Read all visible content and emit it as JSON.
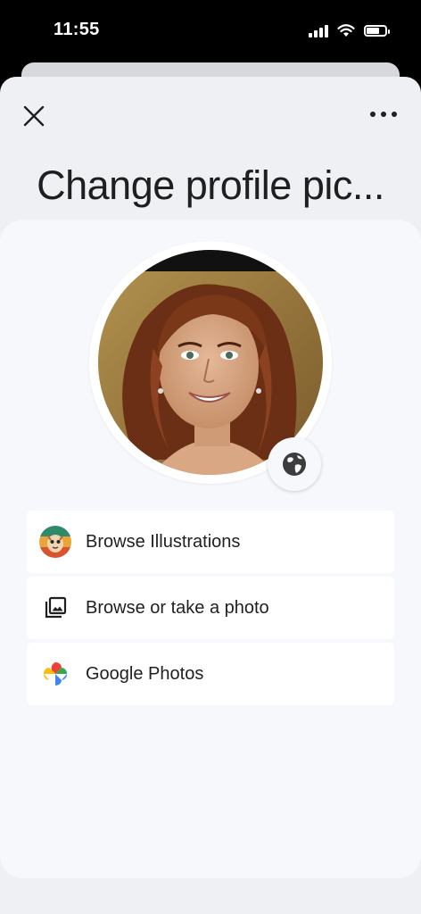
{
  "status_bar": {
    "time": "11:55"
  },
  "header": {
    "title": "Change profile pic..."
  },
  "options": [
    {
      "label": "Browse Illustrations",
      "icon": "illustration-icon"
    },
    {
      "label": "Browse or take a photo",
      "icon": "photo-library-icon"
    },
    {
      "label": "Google Photos",
      "icon": "google-photos-icon"
    }
  ],
  "colors": {
    "sheet_bg": "#eef0f4",
    "card_bg": "#f7f8fc",
    "text": "#1f1f1f"
  }
}
